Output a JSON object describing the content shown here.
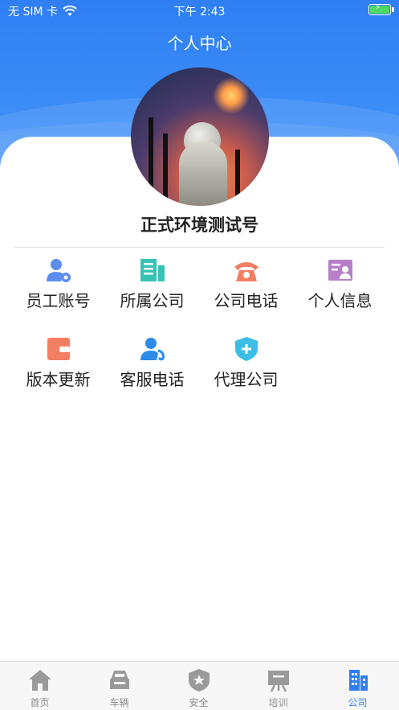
{
  "status": {
    "carrier": "无 SIM 卡",
    "time": "下午 2:43"
  },
  "header": {
    "title": "个人中心"
  },
  "profile": {
    "name": "正式环境测试号"
  },
  "menu": [
    {
      "label": "员工账号",
      "icon": "user-gear-icon",
      "color": "#5b8def"
    },
    {
      "label": "所属公司",
      "icon": "building-icon",
      "color": "#36c2b4"
    },
    {
      "label": "公司电话",
      "icon": "telephone-icon",
      "color": "#f47e63"
    },
    {
      "label": "个人信息",
      "icon": "id-card-icon",
      "color": "#b67fc8"
    },
    {
      "label": "版本更新",
      "icon": "wallet-icon",
      "color": "#f47e63"
    },
    {
      "label": "客服电话",
      "icon": "customer-service-icon",
      "color": "#2e8be8"
    },
    {
      "label": "代理公司",
      "icon": "shield-plus-icon",
      "color": "#3bbde6"
    }
  ],
  "tabs": [
    {
      "label": "首页",
      "icon": "home-icon"
    },
    {
      "label": "车辆",
      "icon": "car-icon"
    },
    {
      "label": "安全",
      "icon": "shield-star-icon"
    },
    {
      "label": "培训",
      "icon": "training-board-icon"
    },
    {
      "label": "公司",
      "icon": "company-building-icon",
      "active": true
    }
  ],
  "colors": {
    "primary": "#2f7ff3",
    "tab_inactive": "#8c8c8c"
  }
}
